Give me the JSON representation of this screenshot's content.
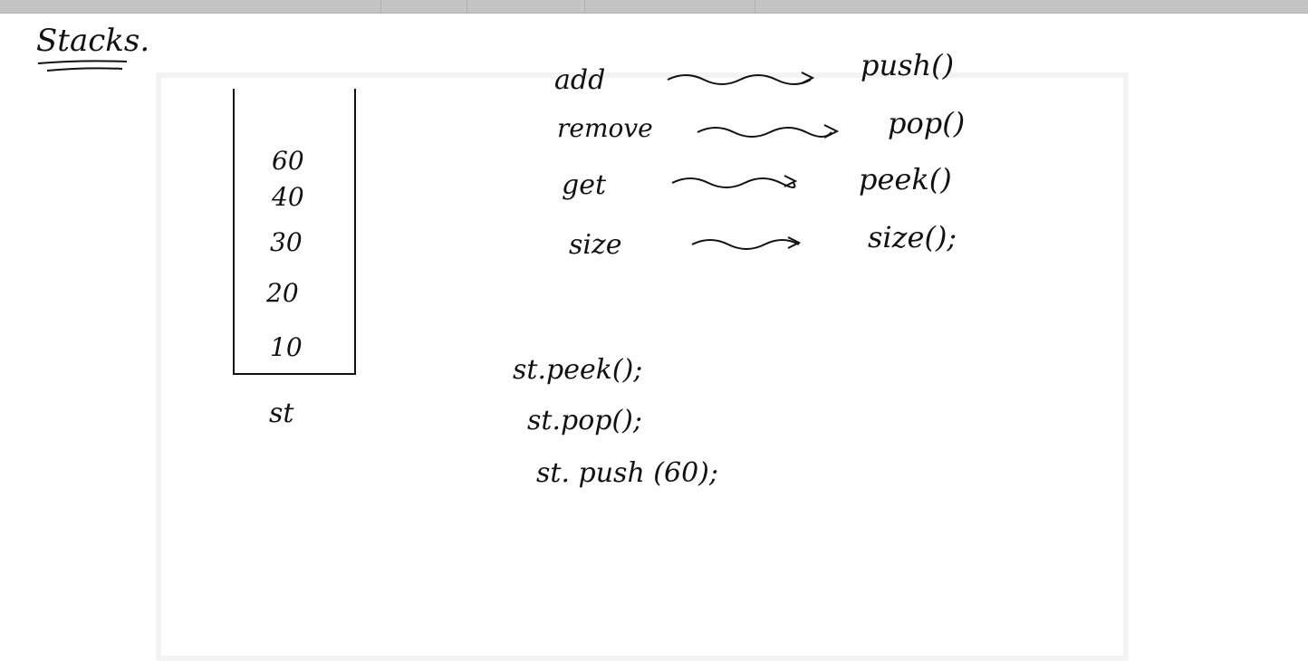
{
  "heading": "Stacks.",
  "stack": {
    "values": [
      "60",
      "40",
      "30",
      "20",
      "10"
    ],
    "name": "st"
  },
  "mappings": [
    {
      "from": "add",
      "to": "push()"
    },
    {
      "from": "remove",
      "to": "pop()"
    },
    {
      "from": "get",
      "to": "peek()"
    },
    {
      "from": "size",
      "to": "size();"
    }
  ],
  "calls": [
    "st.peek();",
    "st.pop();",
    "st. push (60);"
  ]
}
